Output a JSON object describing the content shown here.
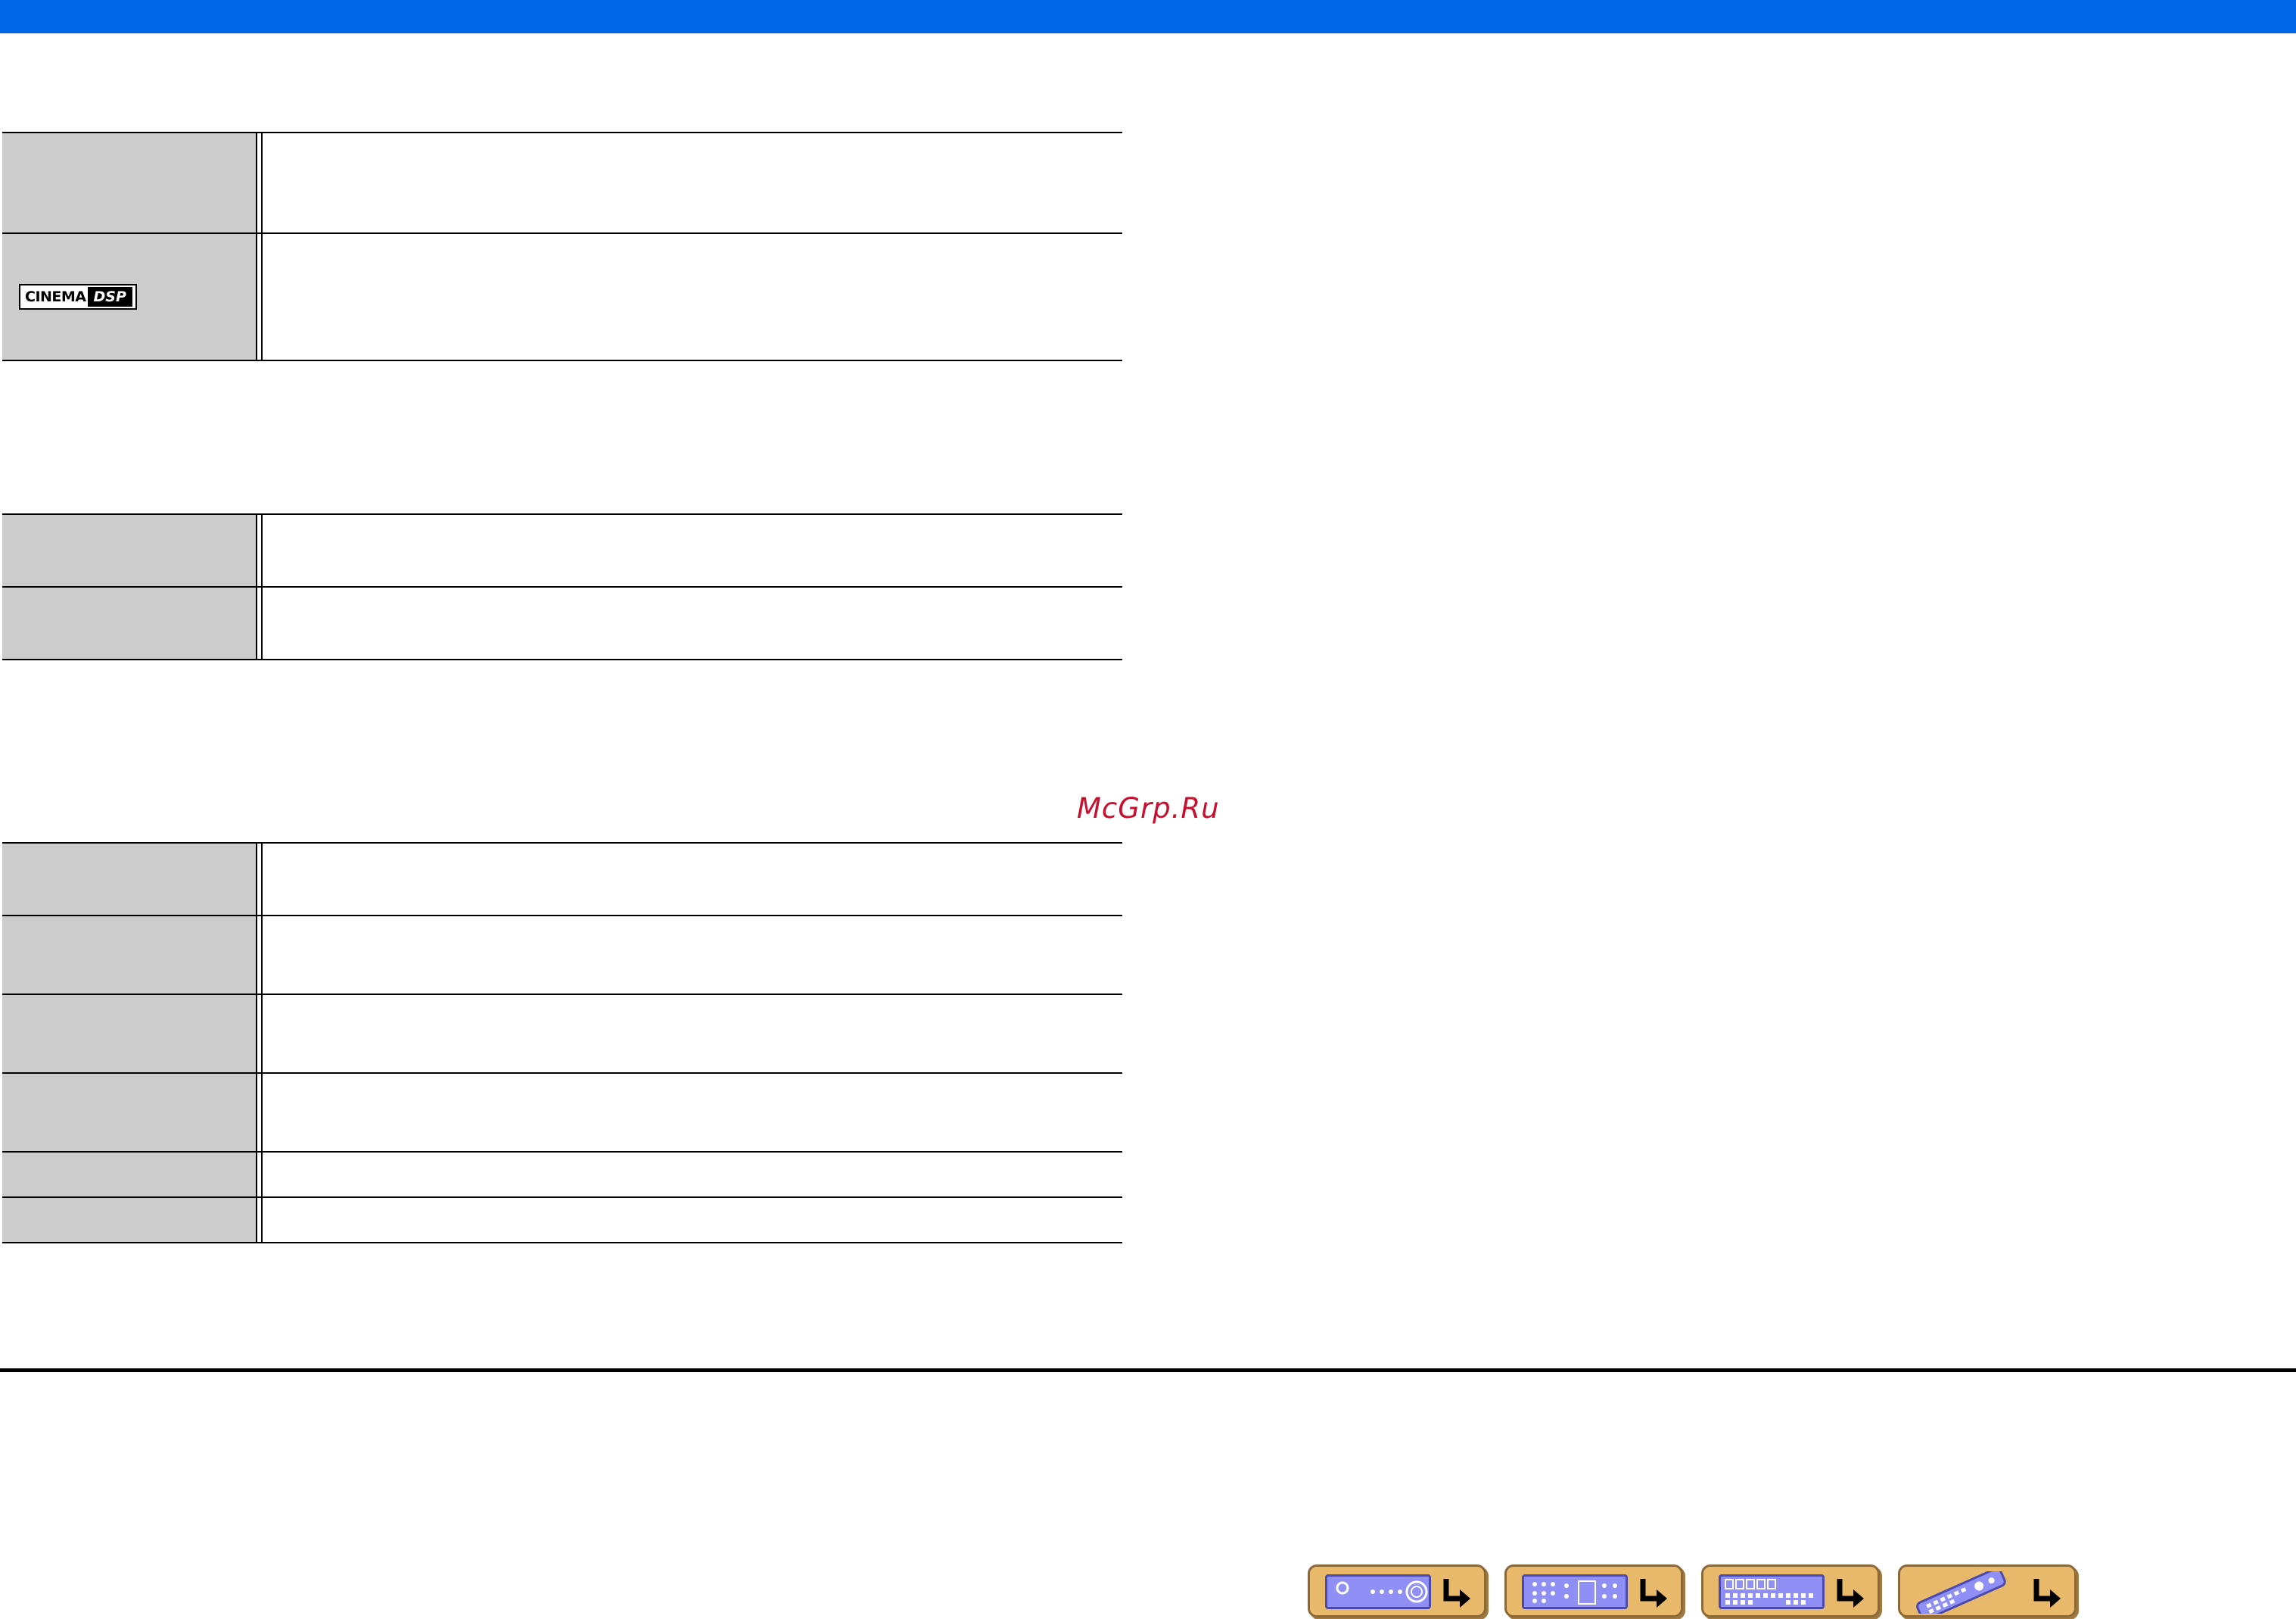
{
  "header": {
    "bar_color": "#0066e6"
  },
  "tables": [
    {
      "rows": [
        {
          "label": "",
          "body": ""
        },
        {
          "label_logo": "cinema-dsp-logo",
          "body": ""
        }
      ]
    },
    {
      "rows": [
        {
          "label": "",
          "body": ""
        },
        {
          "label": "",
          "body": ""
        }
      ]
    },
    {
      "rows": [
        {
          "label": "",
          "body": ""
        },
        {
          "label": "",
          "body": ""
        },
        {
          "label": "",
          "body": ""
        },
        {
          "label": "",
          "body": ""
        },
        {
          "label": "",
          "body": ""
        },
        {
          "label": "",
          "body": ""
        }
      ]
    }
  ],
  "logo": {
    "cinema": "CINEMA",
    "dsp": "DSP"
  },
  "watermark": {
    "text": "McGrp.Ru",
    "color": "#c8102e"
  },
  "nav": {
    "button_color": "#e9b96b",
    "buttons": [
      {
        "icon": "front-panel-icon"
      },
      {
        "icon": "rear-panel-icon"
      },
      {
        "icon": "display-panel-icon"
      },
      {
        "icon": "remote-control-icon"
      }
    ]
  }
}
